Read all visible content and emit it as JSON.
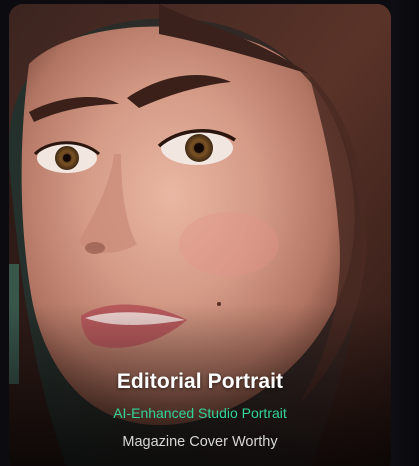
{
  "card": {
    "title": "Editorial Portrait",
    "subtitle": "AI-Enhanced Studio Portrait",
    "tagline": "Magazine Cover Worthy",
    "image_subject": "portrait-photo",
    "colors": {
      "subtitle": "#34d399",
      "title": "#ffffff",
      "tagline": "#d7d7d7",
      "page_background": "#0b0b10"
    }
  }
}
